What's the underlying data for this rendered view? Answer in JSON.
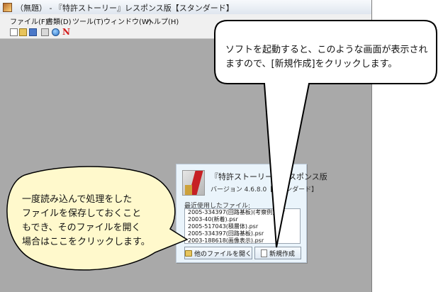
{
  "window": {
    "title": "（無題） - 『特許ストーリー』レスポンス版【スタンダード】"
  },
  "menu": [
    {
      "label": "ファイル(F)"
    },
    {
      "label": "書類(D)"
    },
    {
      "label": "ツール(T)"
    },
    {
      "label": "ウィンドウ(W)"
    },
    {
      "label": "ヘルプ(H)"
    }
  ],
  "toolbar": {
    "icons": [
      "new-document-icon",
      "open-folder-icon",
      "save-icon",
      "print-icon",
      "globe-icon",
      "n-logo-icon"
    ]
  },
  "dialog": {
    "app_name": "『特許ストーリー』レスポンス版",
    "version": "バージョン 4.6.8.0【スタンダード】",
    "recent_label": "最近使用したファイル:",
    "recent_files": [
      "2005-334397(回路基板)(考察例).psr",
      "2003-40(新着).psr",
      "2005-517043(積層体).psr",
      "2005-334397(回路基板).psr",
      "2003-188618(画像表示).psr"
    ],
    "open_other_label": "他のファイルを開く",
    "new_label": "新規作成"
  },
  "callouts": {
    "top": [
      "ソフトを起動すると、このような画面が表示され",
      "ますので、[新規作成]をクリックします。"
    ],
    "left": [
      "一度読み込んで処理をした",
      "ファイルを保存しておくこと",
      "もでき、そのファイルを開く",
      "場合はここをクリックします。"
    ]
  },
  "colors": {
    "workspace": "#a9a9a9",
    "dialog_bg": "#eaf4fb",
    "callout_fill": "#ffffff",
    "callout_left_fill": "#fff9cc",
    "callout_stroke": "#000000",
    "logo_red": "#c62024"
  }
}
